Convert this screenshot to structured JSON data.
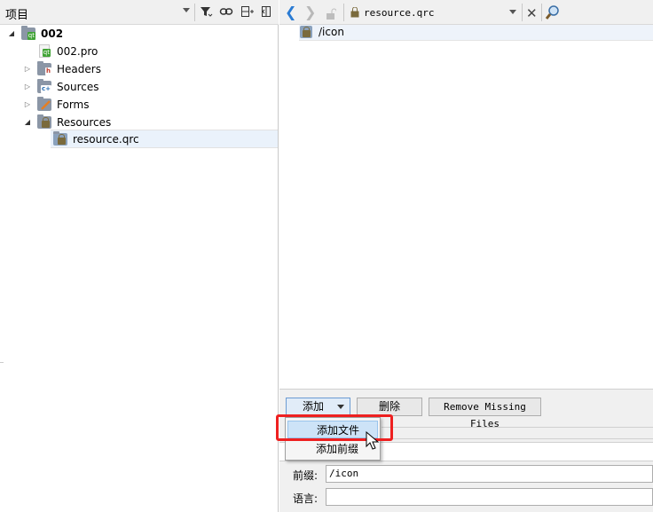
{
  "left_panel": {
    "title": "项目",
    "toolbar_icons": [
      "filter-icon",
      "link-icon",
      "split-icon",
      "close-sidebar-icon"
    ],
    "tree": [
      {
        "label": "002",
        "level": 0,
        "expanded": true,
        "icon": "qt-project-folder-icon",
        "bold": true
      },
      {
        "label": "002.pro",
        "level": 1,
        "icon": "pro-file-icon"
      },
      {
        "label": "Headers",
        "level": 1,
        "expanded": false,
        "icon": "headers-folder-icon"
      },
      {
        "label": "Sources",
        "level": 1,
        "expanded": false,
        "icon": "sources-folder-icon"
      },
      {
        "label": "Forms",
        "level": 1,
        "expanded": false,
        "icon": "forms-folder-icon"
      },
      {
        "label": "Resources",
        "level": 1,
        "expanded": true,
        "icon": "resources-folder-icon"
      },
      {
        "label": "resource.qrc",
        "level": 2,
        "icon": "qrc-file-icon",
        "selected": true
      }
    ]
  },
  "editor": {
    "file_tab": "resource.qrc",
    "prefix_entry": "/icon"
  },
  "actions": {
    "add_label": "添加",
    "delete_label": "删除",
    "remove_missing_label": "Remove Missing Files"
  },
  "add_menu": {
    "items": [
      "添加文件",
      "添加前缀"
    ]
  },
  "properties": {
    "prefix_label": "前缀:",
    "prefix_value": "/icon",
    "language_label": "语言:",
    "language_value": ""
  },
  "colors": {
    "highlight_border": "#ee2020",
    "selection_bg": "#cde3f7",
    "nav_arrow": "#2a7bd3"
  }
}
